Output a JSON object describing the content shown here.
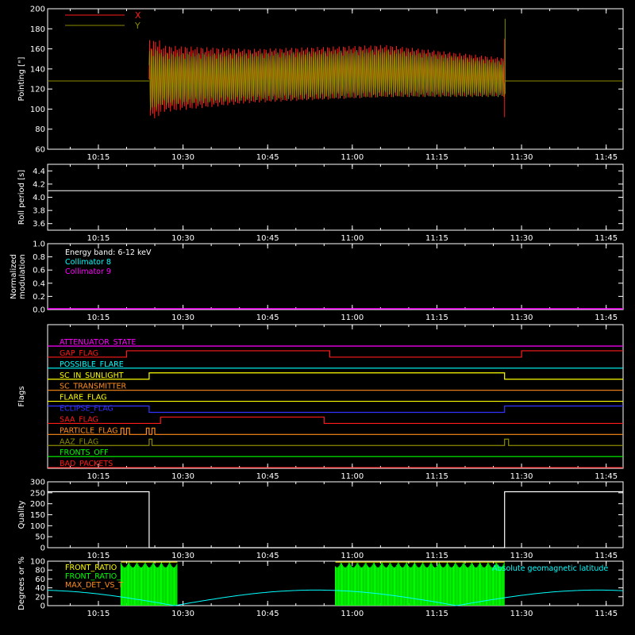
{
  "colors": {
    "bg": "#000000",
    "axis": "#ffffff",
    "x": "#ff1a1a",
    "y": "#8c8c00",
    "cyan": "#00ffff",
    "magenta": "#ff00ff",
    "green": "#00ff00",
    "yellow": "#ffff00",
    "orange": "#ff8c1a",
    "blue": "#3333ff"
  },
  "time_ticks": [
    "10:15",
    "10:30",
    "10:45",
    "11:00",
    "11:15",
    "11:30",
    "11:45"
  ],
  "chart_data": [
    {
      "type": "line",
      "ylabel": "Pointing [\"]",
      "ylim": [
        60,
        200
      ],
      "yticks": [
        "60",
        "80",
        "100",
        "120",
        "140",
        "160",
        "180",
        "200"
      ],
      "legend": [
        "X",
        "Y"
      ],
      "x_range": [
        "10:06",
        "11:48"
      ],
      "series": [
        {
          "name": "X",
          "center": [
            [
              10.25,
              128
            ],
            [
              10.7,
              133
            ],
            [
              11.1,
              138
            ],
            [
              11.45,
              132
            ]
          ],
          "amplitude": [
            [
              10.25,
              38
            ],
            [
              10.7,
              27
            ],
            [
              11.1,
              26
            ],
            [
              11.45,
              19
            ]
          ]
        },
        {
          "name": "Y",
          "center": [
            [
              10.25,
              128
            ],
            [
              10.7,
              132
            ],
            [
              11.1,
              136
            ],
            [
              11.45,
              130
            ]
          ],
          "amplitude": [
            [
              10.25,
              28
            ],
            [
              10.7,
              24
            ],
            [
              11.1,
              24
            ],
            [
              11.45,
              18
            ]
          ]
        }
      ],
      "active_from": "10:24",
      "active_to": "11:27",
      "baseline": 128
    },
    {
      "type": "line",
      "ylabel": "Roll period [s]",
      "ylim": [
        3.5,
        4.5
      ],
      "yticks": [
        "3.6",
        "3.8",
        "4.0",
        "4.2",
        "4.4"
      ],
      "series": [
        {
          "name": "",
          "value": 4.1
        }
      ]
    },
    {
      "type": "line",
      "ylabel": "Normalized modulation",
      "ylim": [
        0.0,
        1.0
      ],
      "yticks": [
        "0.0",
        "0.2",
        "0.4",
        "0.6",
        "0.8",
        "1.0"
      ],
      "annotations": [
        "Energy band: 6-12 keV",
        "Collimator 8",
        "Collimator 9"
      ],
      "series": [
        {
          "name": "Collimator 9",
          "value": 0.0
        }
      ]
    },
    {
      "type": "table",
      "ylabel": "Flags",
      "flags": [
        {
          "name": "ATTENUATOR_STATE",
          "color": "#ff00ff",
          "segments": [
            [
              0,
              "10:06",
              "11:48"
            ]
          ]
        },
        {
          "name": "GAP_FLAG",
          "color": "#ff1a1a",
          "segments": [
            [
              0,
              "10:06",
              "10:20"
            ],
            [
              1,
              "10:20",
              "10:29"
            ],
            [
              1,
              "10:29",
              "10:56"
            ],
            [
              0,
              "10:56",
              "11:30"
            ],
            [
              1,
              "11:30",
              "11:48"
            ]
          ]
        },
        {
          "name": "POSSIBLE_FLARE",
          "color": "#00ffff",
          "segments": [
            [
              0,
              "10:06",
              "11:48"
            ]
          ]
        },
        {
          "name": "SC_IN_SUNLIGHT",
          "color": "#ffff00",
          "segments": [
            [
              0,
              "10:06",
              "10:24"
            ],
            [
              1,
              "10:24",
              "11:27"
            ],
            [
              0,
              "11:27",
              "11:48"
            ]
          ]
        },
        {
          "name": "SC_TRANSMITTER",
          "color": "#ff8c1a",
          "segments": [
            [
              0,
              "10:06",
              "11:48"
            ]
          ]
        },
        {
          "name": "FLARE_FLAG",
          "color": "#ffff00",
          "segments": [
            [
              0,
              "10:06",
              "11:48"
            ]
          ]
        },
        {
          "name": "ECLIPSE_FLAG",
          "color": "#3333ff",
          "segments": [
            [
              1,
              "10:06",
              "10:24"
            ],
            [
              0,
              "10:24",
              "11:27"
            ],
            [
              1,
              "11:27",
              "11:48"
            ]
          ]
        },
        {
          "name": "SAA_FLAG",
          "color": "#ff1a1a",
          "segments": [
            [
              0,
              "10:06",
              "10:26"
            ],
            [
              1,
              "10:26",
              "10:55"
            ],
            [
              0,
              "10:55",
              "11:48"
            ]
          ]
        },
        {
          "name": "PARTICLE_FLAG",
          "color": "#ff8c1a",
          "segments": [
            [
              0,
              "10:06",
              "10:19"
            ],
            [
              1,
              "10:19",
              "10:19.5"
            ],
            [
              0,
              "10:19.5",
              "10:20"
            ],
            [
              1,
              "10:20",
              "10:20.5"
            ],
            [
              0,
              "10:20.5",
              "10:23.5"
            ],
            [
              1,
              "10:23.5",
              "10:24"
            ],
            [
              0,
              "10:24",
              "10:24.5"
            ],
            [
              1,
              "10:24.5",
              "10:25"
            ],
            [
              0,
              "10:25",
              "11:48"
            ]
          ]
        },
        {
          "name": "AAZ_FLAG",
          "color": "#8c8c00",
          "segments": [
            [
              0,
              "10:06",
              "10:24"
            ],
            [
              1,
              "10:24",
              "10:24.5"
            ],
            [
              0,
              "10:24.5",
              "11:27"
            ],
            [
              1,
              "11:27",
              "11:27.7"
            ],
            [
              0,
              "11:27.7",
              "11:48"
            ]
          ]
        },
        {
          "name": "FRONTS_OFF",
          "color": "#00ff00",
          "segments": [
            [
              0,
              "10:06",
              "11:48"
            ]
          ]
        },
        {
          "name": "BAD_PACKETS",
          "color": "#ff1a1a",
          "segments": [
            [
              0,
              "10:06",
              "11:48"
            ]
          ]
        }
      ]
    },
    {
      "type": "line",
      "ylabel": "Quality",
      "ylim": [
        0,
        300
      ],
      "yticks": [
        "0",
        "50",
        "100",
        "150",
        "200",
        "250",
        "300"
      ],
      "series": [
        {
          "name": "",
          "points": [
            [
              "10:06",
              255
            ],
            [
              "10:24",
              255
            ],
            [
              "10:24",
              0
            ],
            [
              "11:27",
              0
            ],
            [
              "11:27",
              255
            ],
            [
              "11:48",
              255
            ]
          ]
        }
      ]
    },
    {
      "type": "line",
      "ylabel": "Degrees or %",
      "ylim": [
        0,
        100
      ],
      "yticks": [
        "0",
        "20",
        "40",
        "60",
        "80",
        "100"
      ],
      "legend": [
        "FRONT_RATIO",
        "FRONT_RATIO_",
        "MAX_DET_VS_T"
      ],
      "annotations": [
        "Absolute geomagnetic latitude"
      ],
      "series": [
        {
          "name": "Absolute geomagnetic latitude",
          "cos_wave": {
            "amp": 35,
            "zeros": [
              "10:28.5",
              "11:18.5"
            ]
          }
        },
        {
          "name": "FRONT_RATIO",
          "spikes": [
            [
              "10:19",
              "10:29"
            ],
            [
              "10:57",
              "11:27"
            ]
          ],
          "base": 0,
          "top": 98
        }
      ]
    }
  ]
}
